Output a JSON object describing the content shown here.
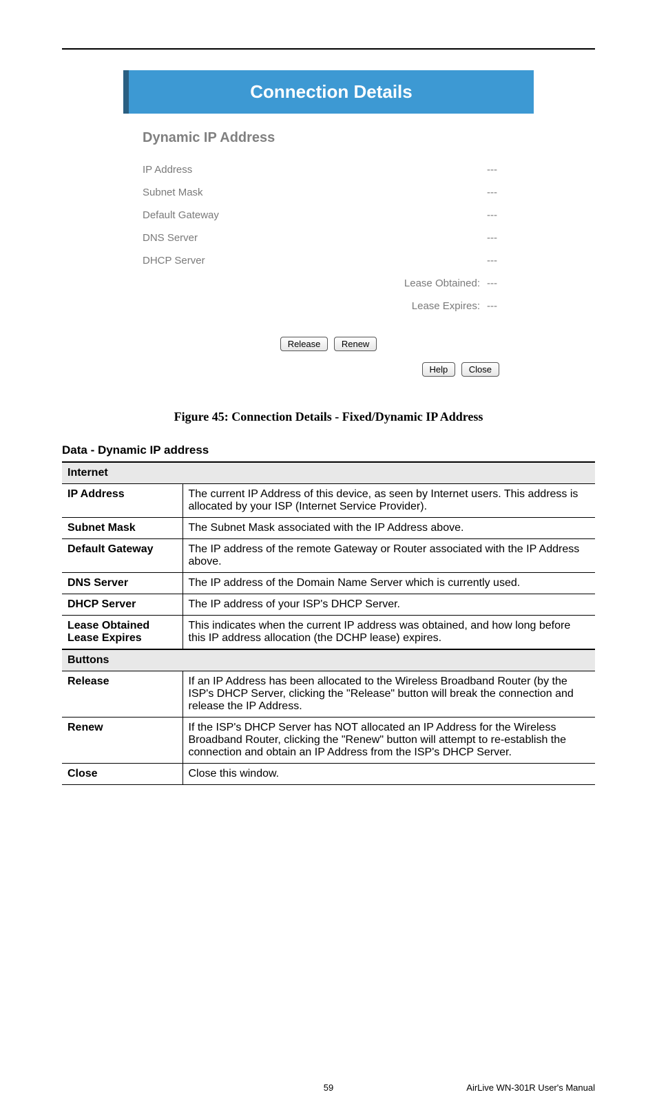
{
  "screenshot": {
    "title": "Connection Details",
    "subtitle": "Dynamic IP Address",
    "rows": [
      {
        "label": "IP Address",
        "value": "---",
        "align": "left"
      },
      {
        "label": "Subnet Mask",
        "value": "---",
        "align": "left"
      },
      {
        "label": "Default Gateway",
        "value": "---",
        "align": "left"
      },
      {
        "label": "DNS Server",
        "value": "---",
        "align": "left"
      },
      {
        "label": "DHCP Server",
        "value": "---",
        "align": "left"
      },
      {
        "label": "Lease Obtained:",
        "value": "---",
        "align": "right"
      },
      {
        "label": "Lease Expires:",
        "value": "---",
        "align": "right"
      }
    ],
    "buttons": {
      "release": "Release",
      "renew": "Renew",
      "help": "Help",
      "close": "Close"
    }
  },
  "figure_caption": "Figure 45: Connection Details - Fixed/Dynamic IP Address",
  "section_heading": "Data - Dynamic IP address",
  "table": {
    "group1": "Internet",
    "group2": "Buttons",
    "rows1": [
      {
        "label": "IP Address",
        "desc": "The current IP Address of this device, as seen by Internet users. This address is allocated by your ISP (Internet Service Provider)."
      },
      {
        "label": "Subnet Mask",
        "desc": "The Subnet Mask associated with the IP Address above."
      },
      {
        "label": "Default Gateway",
        "desc": "The IP address of the remote Gateway or Router associated with the IP Address above."
      },
      {
        "label": "DNS Server",
        "desc": "The IP address of the Domain Name Server which is currently used."
      },
      {
        "label": "DHCP Server",
        "desc": "The IP address of your ISP's DHCP Server."
      },
      {
        "label": "Lease Obtained\nLease Expires",
        "desc": "This indicates when the current IP address was obtained, and how long before this IP address allocation (the DCHP lease) expires."
      }
    ],
    "rows2": [
      {
        "label": "Release",
        "desc": "If an IP Address has been allocated to the Wireless Broadband Router (by the ISP's DHCP Server, clicking the \"Release\" button will break the connection and release the IP Address."
      },
      {
        "label": "Renew",
        "desc": "If the ISP's DHCP Server has NOT allocated an IP Address for the Wireless Broadband Router, clicking the \"Renew\" button will attempt to re-establish the connection and obtain an IP Address from the ISP's DHCP Server."
      },
      {
        "label": "Close",
        "desc": "Close this window."
      }
    ]
  },
  "footer": {
    "page": "59",
    "manual": "AirLive WN-301R User's Manual"
  }
}
